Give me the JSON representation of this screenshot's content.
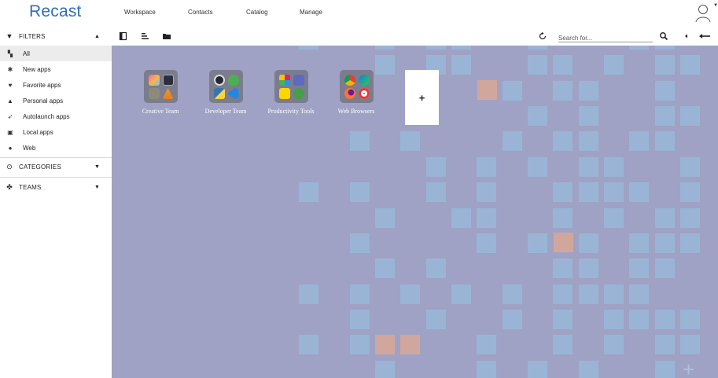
{
  "app": {
    "logo": "Recast"
  },
  "nav": [
    "Workspace",
    "Contacts",
    "Catalog",
    "Manage"
  ],
  "sidebar": {
    "filters_label": "FILTERS",
    "filters": [
      {
        "label": "All",
        "icon": "grid-icon",
        "active": true
      },
      {
        "label": "New apps",
        "icon": "sparkle-icon"
      },
      {
        "label": "Favorite apps",
        "icon": "heart-icon"
      },
      {
        "label": "Personal apps",
        "icon": "person-icon"
      },
      {
        "label": "Autolaunch apps",
        "icon": "rocket-icon"
      },
      {
        "label": "Local apps",
        "icon": "monitor-icon"
      },
      {
        "label": "Web",
        "icon": "globe-icon"
      }
    ],
    "categories_label": "CATEGORIES",
    "teams_label": "TEAMS"
  },
  "toolbar": {
    "search_placeholder": "Search for..."
  },
  "workspace": {
    "folders": [
      {
        "name": "Creative Team"
      },
      {
        "name": "Developer Team"
      },
      {
        "name": "Productivity Tools"
      },
      {
        "name": "Web Browsers"
      }
    ],
    "add_label": "+",
    "corner_label": "+"
  },
  "colors": {
    "accent": "#2d6fb8",
    "workspace_bg": "#9fa2c4",
    "tile_blue": "#9ab4d6",
    "tile_orange": "#d1a79d",
    "folder_bg": "#7b7d8e"
  }
}
